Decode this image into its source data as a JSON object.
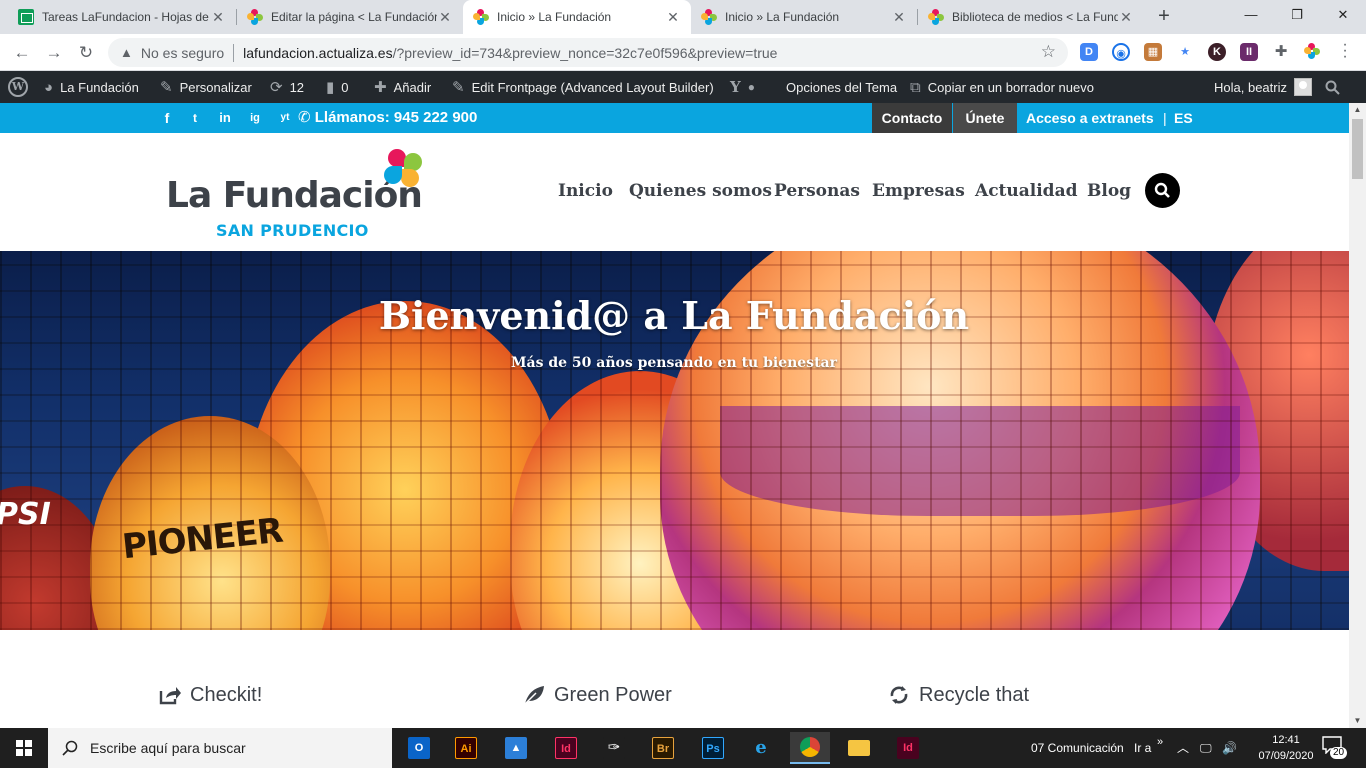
{
  "browser": {
    "tabs": [
      {
        "title": "Tareas LaFundacion - Hojas de"
      },
      {
        "title": "Editar la página < La Fundación"
      },
      {
        "title": "Inicio » La Fundación"
      },
      {
        "title": "Inicio » La Fundación"
      },
      {
        "title": "Biblioteca de medios < La Fund"
      }
    ],
    "new_tab": "+",
    "security_label": "No es seguro",
    "url_host": "lafundacion.actualiza.es",
    "url_path": "/?preview_id=734&preview_nonce=32c7e0f596&preview=true"
  },
  "admin_bar": {
    "site_name": "La Fundación",
    "customize": "Personalizar",
    "updates_count": "12",
    "comments_count": "0",
    "add_new": "Añadir",
    "edit_frontpage": "Edit Frontpage (Advanced Layout Builder)",
    "theme_options": "Opciones del Tema",
    "copy_draft": "Copiar en un borrador nuevo",
    "greeting": "Hola, beatriz"
  },
  "topbar": {
    "social": [
      "f",
      "t",
      "in",
      "ig",
      "yt"
    ],
    "phone": "Llámanos: 945 222 900",
    "contacto": "Contacto",
    "unete": "Únete",
    "extranet": "Acceso a extranets",
    "lang": "ES"
  },
  "header": {
    "logo_main": "La Fundación",
    "logo_sub": "SAN PRUDENCIO",
    "nav": [
      "Inicio",
      "Quienes somos",
      "Personas",
      "Empresas",
      "Actualidad",
      "Blog"
    ]
  },
  "hero": {
    "title": "Bienvenid@ a La Fundación",
    "subtitle": "Más de 50 años pensando en tu bienestar",
    "balloon_text_1": "PIONEER",
    "balloon_text_2": "PSI"
  },
  "features": [
    {
      "title": "Checkit!",
      "icon": "share-icon"
    },
    {
      "title": "Green Power",
      "icon": "leaf-icon"
    },
    {
      "title": "Recycle that",
      "icon": "recycle-icon"
    }
  ],
  "taskbar": {
    "search_placeholder": "Escribe aquí para buscar",
    "tray_item": "07 Comunicación",
    "tray_goto": "Ir a",
    "time": "12:41",
    "date": "07/09/2020",
    "notifications": "20"
  },
  "colors": {
    "brand_blue": "#0aa5df",
    "admin_bar": "#23282d",
    "magenta": "#e7175b",
    "green": "#8cc63f",
    "orange": "#f9b233"
  }
}
